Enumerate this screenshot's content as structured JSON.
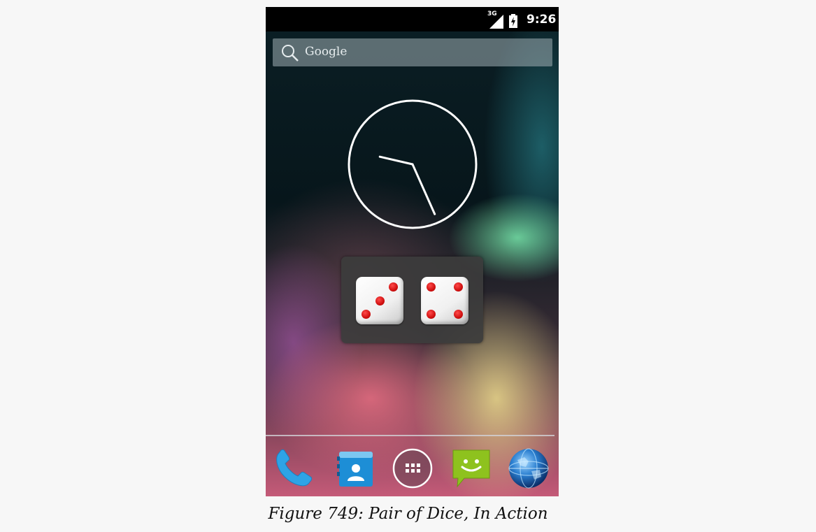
{
  "status_bar": {
    "network": "3G",
    "time": "9:26"
  },
  "search": {
    "label": "Google",
    "icon": "search-icon"
  },
  "clock": {
    "time": "9:26",
    "icon": "analog-clock"
  },
  "dice_widget": {
    "dice": [
      {
        "value": 3
      },
      {
        "value": 4
      }
    ],
    "pip_color": "#d01010"
  },
  "dock": {
    "items": [
      {
        "icon": "phone-icon"
      },
      {
        "icon": "contacts-icon"
      },
      {
        "icon": "app-drawer-icon"
      },
      {
        "icon": "messaging-icon"
      },
      {
        "icon": "browser-globe-icon"
      }
    ]
  },
  "caption": "Figure 749: Pair of Dice, In Action"
}
